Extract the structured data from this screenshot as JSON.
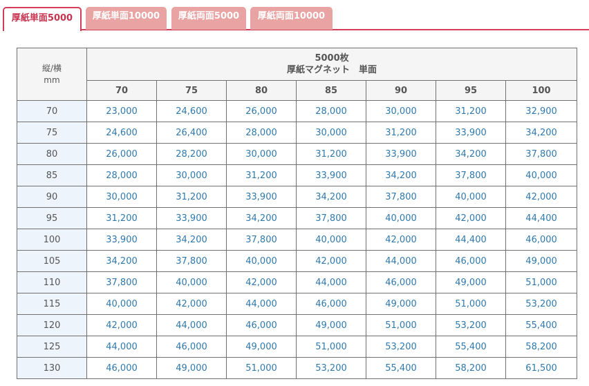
{
  "tabs": [
    {
      "label": "厚紙単面5000",
      "active": true
    },
    {
      "label": "厚紙単面10000",
      "active": false
    },
    {
      "label": "厚紙両面5000",
      "active": false
    },
    {
      "label": "厚紙両面10000",
      "active": false
    }
  ],
  "table": {
    "corner_line1": "縦/横",
    "corner_line2": "mm",
    "title_line1": "5000枚",
    "title_line2": "厚紙マグネット　単面",
    "columns": [
      "70",
      "75",
      "80",
      "85",
      "90",
      "95",
      "100"
    ],
    "rows": [
      {
        "label": "70",
        "values": [
          "23,000",
          "24,600",
          "26,000",
          "28,000",
          "30,000",
          "31,200",
          "32,900"
        ]
      },
      {
        "label": "75",
        "values": [
          "24,600",
          "26,400",
          "28,000",
          "30,000",
          "31,200",
          "33,900",
          "34,200"
        ]
      },
      {
        "label": "80",
        "values": [
          "26,000",
          "28,200",
          "30,000",
          "31,200",
          "33,900",
          "34,200",
          "37,800"
        ]
      },
      {
        "label": "85",
        "values": [
          "28,000",
          "30,000",
          "31,200",
          "33,900",
          "34,200",
          "37,800",
          "40,000"
        ]
      },
      {
        "label": "90",
        "values": [
          "30,000",
          "31,200",
          "33,900",
          "34,200",
          "37,800",
          "40,000",
          "42,000"
        ]
      },
      {
        "label": "95",
        "values": [
          "31,200",
          "33,900",
          "34,200",
          "37,800",
          "40,000",
          "42,000",
          "44,400"
        ]
      },
      {
        "label": "100",
        "values": [
          "33,900",
          "34,200",
          "37,800",
          "40,000",
          "42,000",
          "44,400",
          "46,000"
        ]
      },
      {
        "label": "105",
        "values": [
          "34,200",
          "37,800",
          "40,000",
          "42,000",
          "44,000",
          "46,000",
          "49,000"
        ]
      },
      {
        "label": "110",
        "values": [
          "37,800",
          "40,000",
          "42,000",
          "44,000",
          "46,000",
          "49,000",
          "51,000"
        ]
      },
      {
        "label": "115",
        "values": [
          "40,000",
          "42,000",
          "44,000",
          "46,000",
          "49,000",
          "51,000",
          "53,200"
        ]
      },
      {
        "label": "120",
        "values": [
          "42,000",
          "44,000",
          "46,000",
          "49,000",
          "51,000",
          "53,200",
          "55,400"
        ]
      },
      {
        "label": "125",
        "values": [
          "44,000",
          "46,000",
          "49,000",
          "51,000",
          "53,200",
          "55,400",
          "58,200"
        ]
      },
      {
        "label": "130",
        "values": [
          "46,000",
          "49,000",
          "51,000",
          "53,200",
          "55,400",
          "58,200",
          "61,500"
        ]
      }
    ]
  }
}
